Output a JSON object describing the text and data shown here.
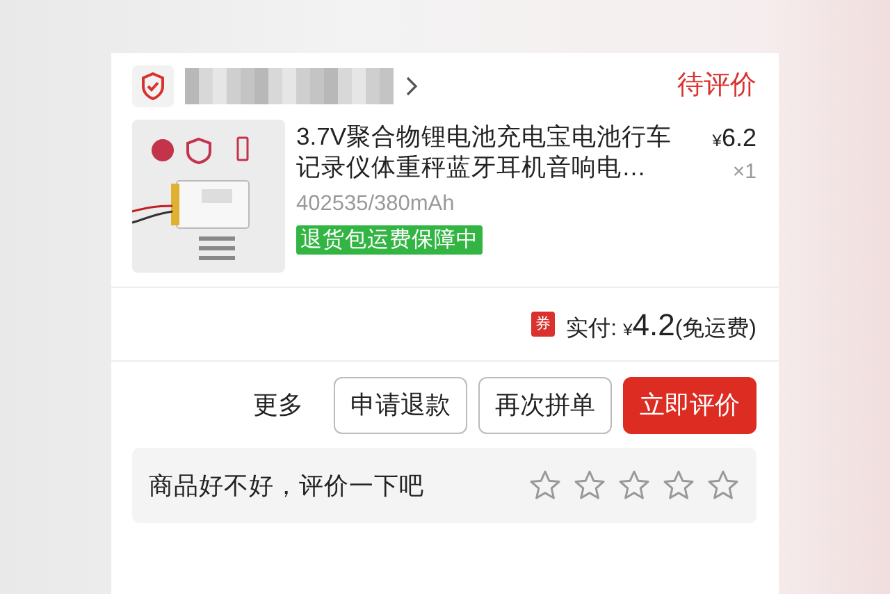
{
  "shop": {
    "status": "待评价"
  },
  "product": {
    "title": "3.7V聚合物锂电池充电宝电池行车记录仪体重秤蓝牙耳机音响电…",
    "spec": "402535/380mAh",
    "tag": "退货包运费保障中",
    "currency": "¥",
    "price": "6.2",
    "quantity": "×1"
  },
  "payment": {
    "coupon": "券",
    "label": "实付:",
    "currency": "¥",
    "amount": "4.2",
    "note": "(免运费)"
  },
  "actions": [
    {
      "label": "更多",
      "kind": "link"
    },
    {
      "label": "申请退款",
      "kind": "outline"
    },
    {
      "label": "再次拼单",
      "kind": "outline"
    },
    {
      "label": "立即评价",
      "kind": "primary"
    }
  ],
  "review": {
    "prompt": "商品好不好，评价一下吧",
    "stars": 0
  }
}
